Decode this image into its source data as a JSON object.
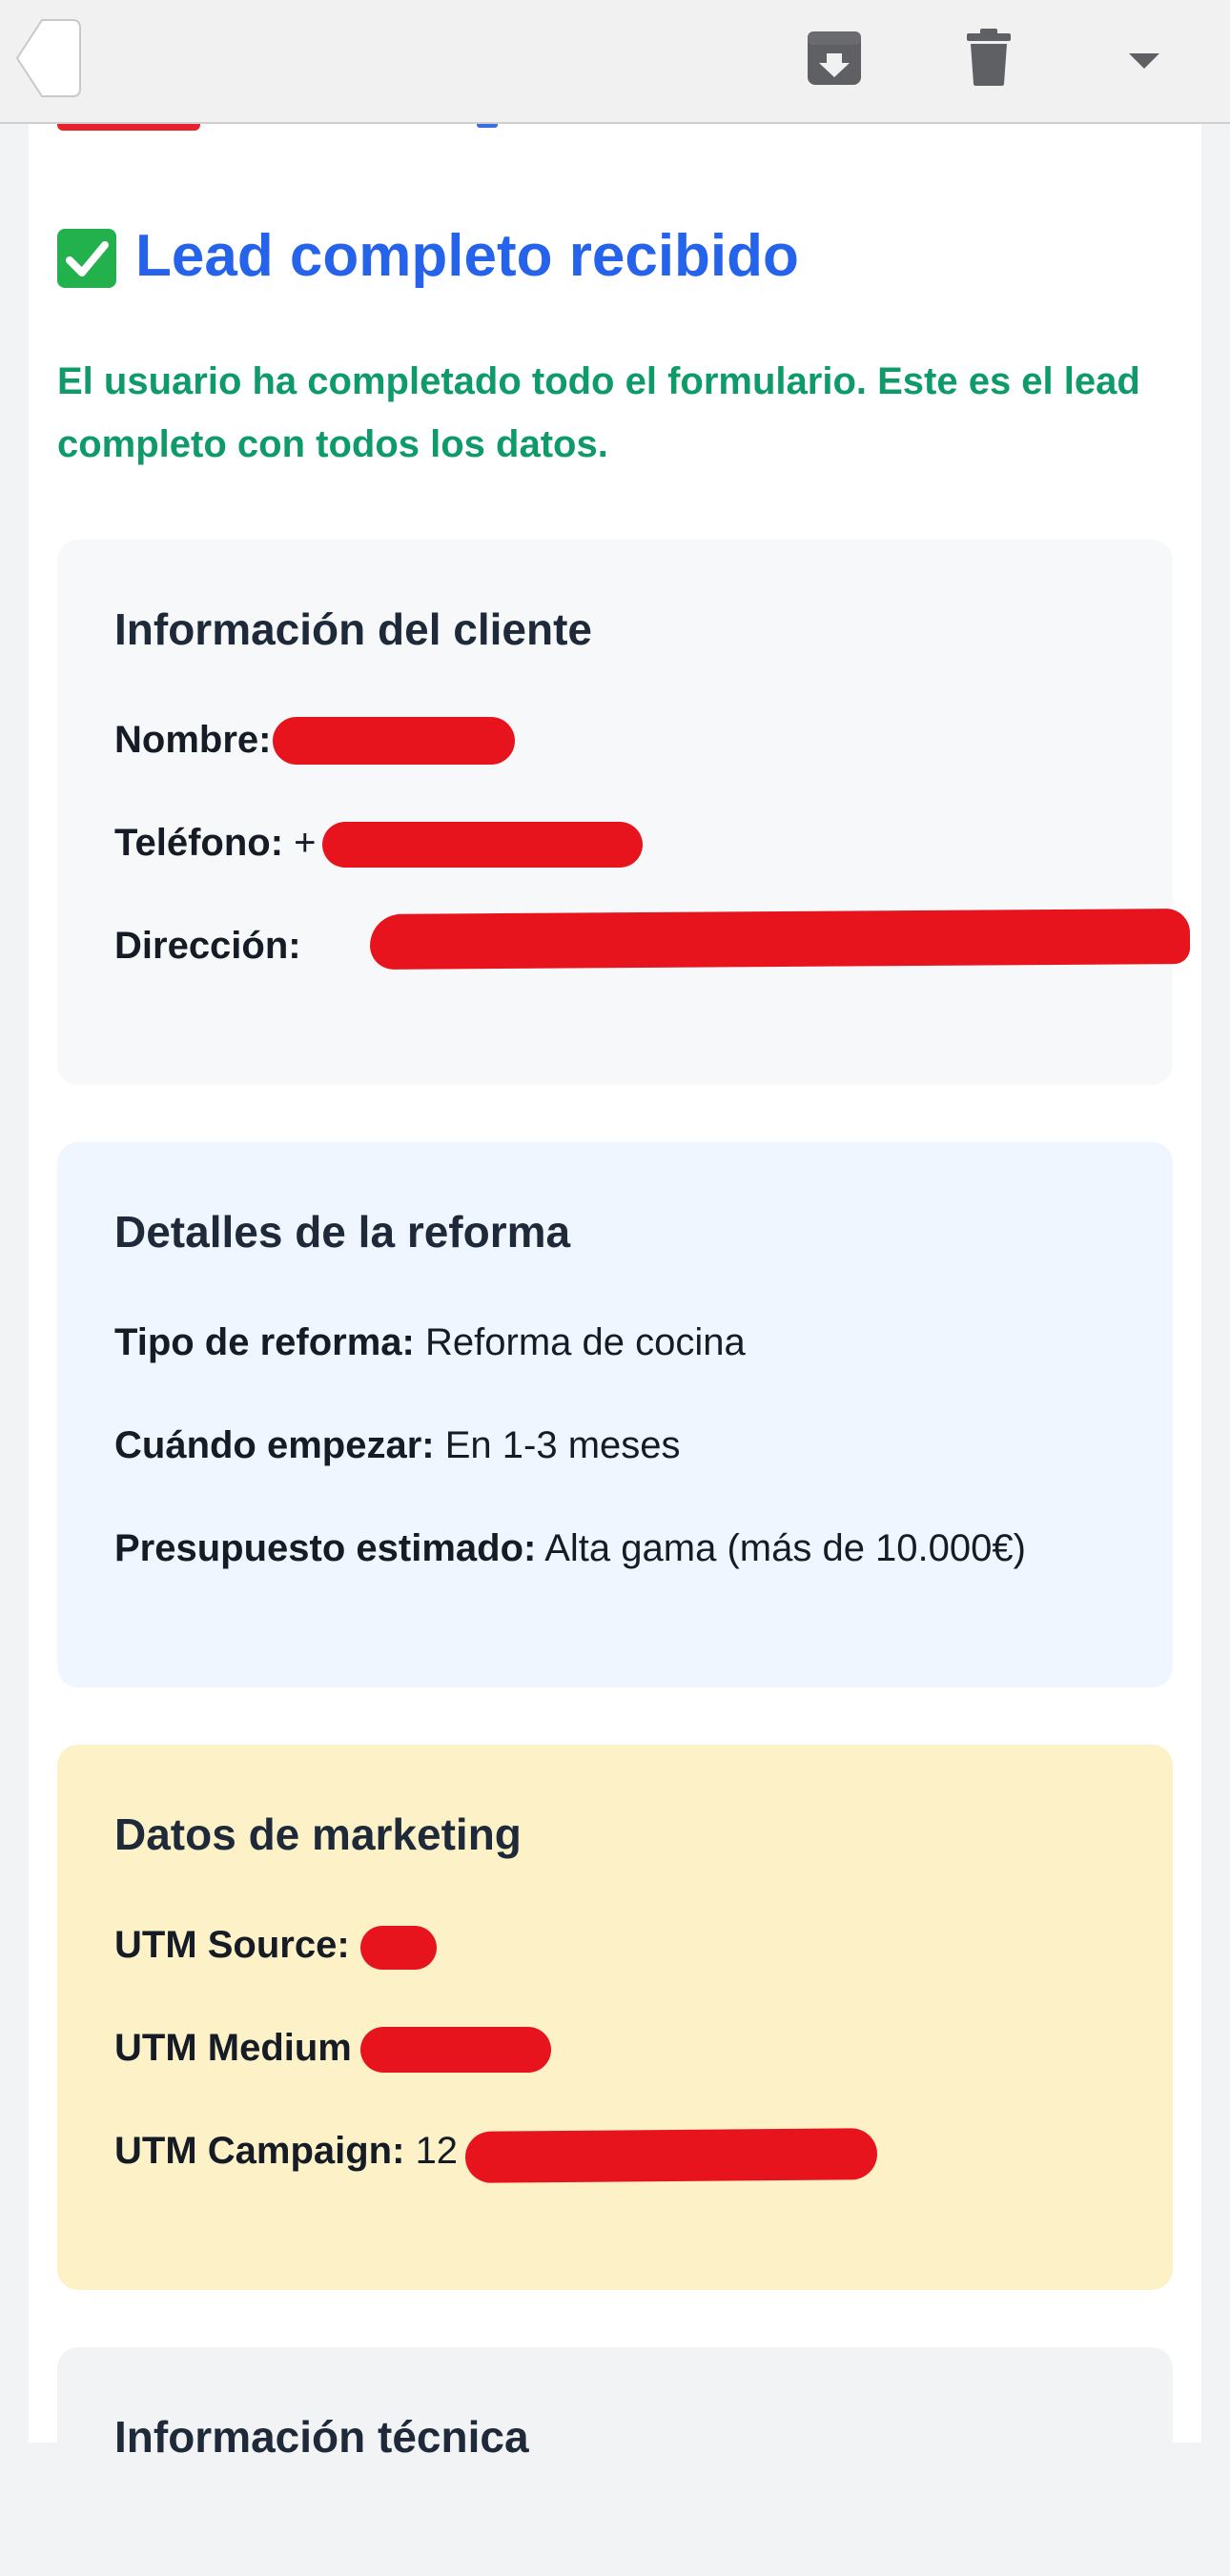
{
  "toolbar": {
    "back_icon": "chevron-left-icon",
    "archive_icon": "archive-box-icon",
    "delete_icon": "trash-icon",
    "more_icon": "caret-down-icon"
  },
  "email": {
    "headline": "Lead completo recibido",
    "headline_icon": "check-mark-button-icon",
    "intro": "El usuario ha completado todo el formulario. Este es el lead completo con todos los datos."
  },
  "client_info": {
    "title": "Información del cliente",
    "name_label": "Nombre:",
    "phone_label": "Teléfono:",
    "phone_value_visible": "+",
    "address_label": "Dirección:"
  },
  "reform_details": {
    "title": "Detalles de la reforma",
    "type_label": "Tipo de reforma:",
    "type_value": "Reforma de cocina",
    "start_label": "Cuándo empezar:",
    "start_value": "En 1-3 meses",
    "budget_label": "Presupuesto estimado:",
    "budget_value": "Alta gama (más de 10.000€)"
  },
  "marketing": {
    "title": "Datos de marketing",
    "source_label": "UTM Source:",
    "medium_label": "UTM Medium",
    "campaign_label": "UTM Campaign:",
    "campaign_value_visible": "12"
  },
  "technical": {
    "title": "Información técnica"
  },
  "colors": {
    "headline": "#2563eb",
    "intro": "#0f9a6a",
    "redaction": "#e8141d",
    "client_bg": "#f7f8fa",
    "reform_bg": "#eff6ff",
    "marketing_bg": "#fdf2c7"
  }
}
